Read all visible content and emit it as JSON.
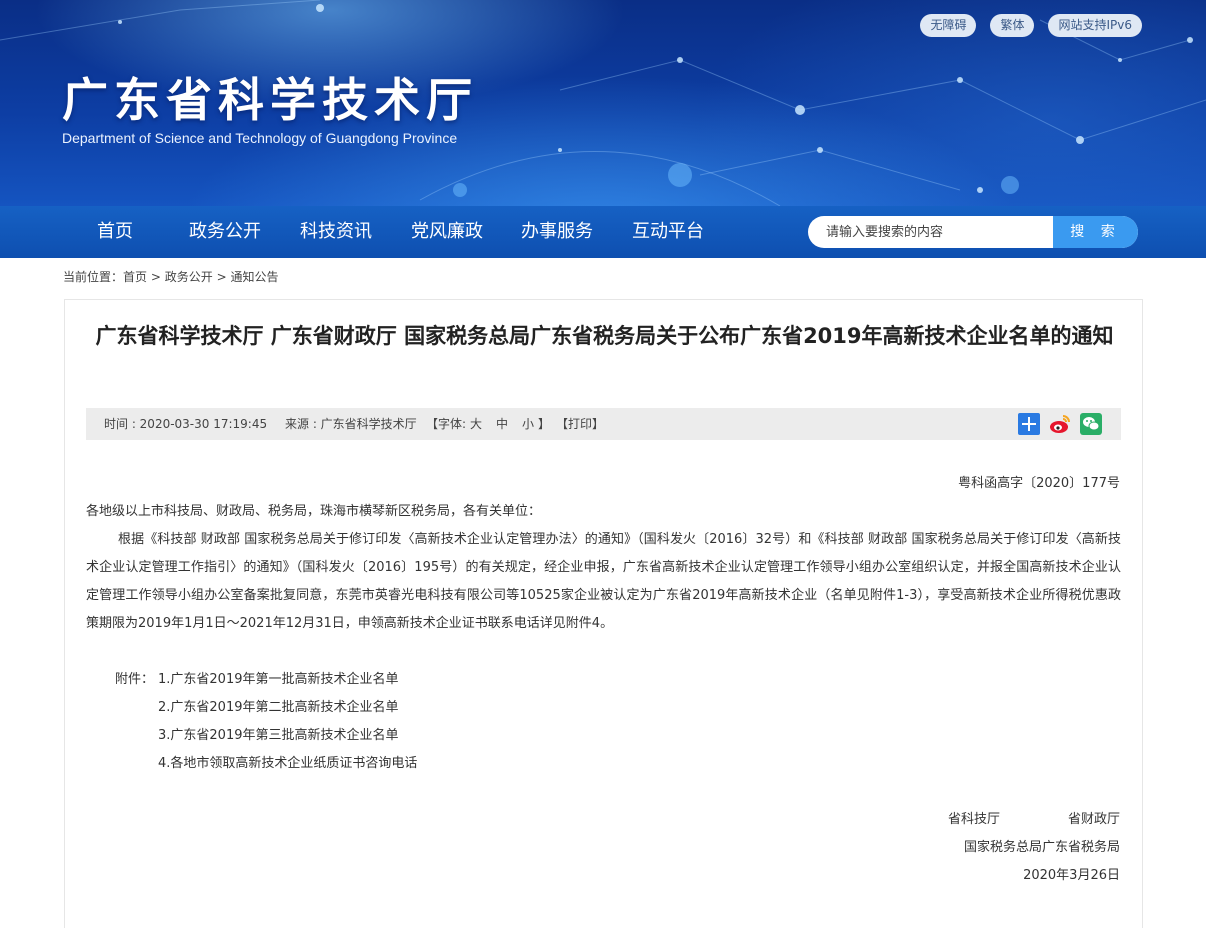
{
  "header": {
    "site_title": "广东省科学技术厅",
    "site_subtitle": "Department of Science and Technology of Guangdong Province",
    "top_links": [
      "无障碍",
      "繁体",
      "网站支持IPv6"
    ]
  },
  "nav": {
    "items": [
      "首页",
      "政务公开",
      "科技资讯",
      "党风廉政",
      "办事服务",
      "互动平台"
    ],
    "search_placeholder": "请输入要搜索的内容",
    "search_button": "搜 索"
  },
  "breadcrumb": {
    "prefix": "当前位置：",
    "items": [
      "首页",
      "政务公开",
      "通知公告"
    ],
    "separator": ">"
  },
  "article": {
    "title": "广东省科学技术厅 广东省财政厅 国家税务总局广东省税务局关于公布广东省2019年高新技术企业名单的通知",
    "meta": {
      "time": "时间 : 2020-03-30 17:19:45",
      "source": "来源 : 广东省科学技术厅",
      "font_open": "【字体:",
      "font_large": "大",
      "font_medium": "中",
      "font_small": "小",
      "font_close": "】",
      "print": "【打印】"
    },
    "share_icons": [
      "plus-share-icon",
      "weibo-icon",
      "wechat-icon"
    ],
    "colors": {
      "accent": "#1661c4",
      "weibo": "#e6162d",
      "wechat": "#2aae67",
      "share": "#2a7ae2"
    },
    "doc_number": "粤科函高字〔2020〕177号",
    "addressee": "各地级以上市科技局、财政局、税务局，珠海市横琴新区税务局，各有关单位：",
    "body": "根据《科技部 财政部 国家税务总局关于修订印发〈高新技术企业认定管理办法〉的通知》（国科发火〔2016〕32号）和《科技部 财政部 国家税务总局关于修订印发〈高新技术企业认定管理工作指引〉的通知》（国科发火〔2016〕195号）的有关规定，经企业申报，广东省高新技术企业认定管理工作领导小组办公室组织认定，并报全国高新技术企业认定管理工作领导小组办公室备案批复同意，东莞市英睿光电科技有限公司等10525家企业被认定为广东省2019年高新技术企业（名单见附件1-3），享受高新技术企业所得税优惠政策期限为2019年1月1日～2021年12月31日，申领高新技术企业证书联系电话详见附件4。",
    "attachments_label": "附件：",
    "attachments": [
      "1.广东省2019年第一批高新技术企业名单",
      "2.广东省2019年第二批高新技术企业名单",
      "3.广东省2019年第三批高新技术企业名单",
      "4.各地市领取高新技术企业纸质证书咨询电话"
    ],
    "signatures": {
      "sig1": "省科技厅",
      "sig2": "省财政厅",
      "sig3": "国家税务总局广东省税务局",
      "date": "2020年3月26日"
    }
  }
}
